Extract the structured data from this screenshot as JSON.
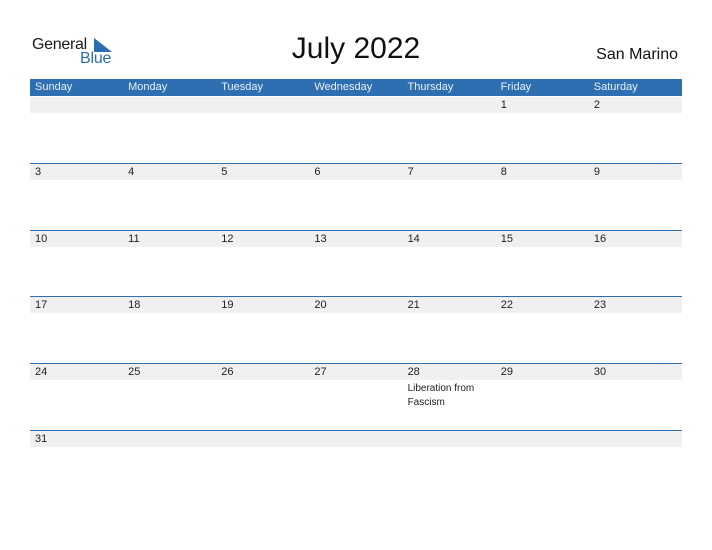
{
  "logo": {
    "word1": "General",
    "word2": "Blue"
  },
  "title": "July 2022",
  "country": "San Marino",
  "colors": {
    "accent": "#2e6fb1",
    "strip": "#f0f0f0"
  },
  "weekdays": [
    "Sunday",
    "Monday",
    "Tuesday",
    "Wednesday",
    "Thursday",
    "Friday",
    "Saturday"
  ],
  "weeks": [
    [
      {
        "day": ""
      },
      {
        "day": ""
      },
      {
        "day": ""
      },
      {
        "day": ""
      },
      {
        "day": ""
      },
      {
        "day": "1"
      },
      {
        "day": "2"
      }
    ],
    [
      {
        "day": "3"
      },
      {
        "day": "4"
      },
      {
        "day": "5"
      },
      {
        "day": "6"
      },
      {
        "day": "7"
      },
      {
        "day": "8"
      },
      {
        "day": "9"
      }
    ],
    [
      {
        "day": "10"
      },
      {
        "day": "11"
      },
      {
        "day": "12"
      },
      {
        "day": "13"
      },
      {
        "day": "14"
      },
      {
        "day": "15"
      },
      {
        "day": "16"
      }
    ],
    [
      {
        "day": "17"
      },
      {
        "day": "18"
      },
      {
        "day": "19"
      },
      {
        "day": "20"
      },
      {
        "day": "21"
      },
      {
        "day": "22"
      },
      {
        "day": "23"
      }
    ],
    [
      {
        "day": "24"
      },
      {
        "day": "25"
      },
      {
        "day": "26"
      },
      {
        "day": "27"
      },
      {
        "day": "28",
        "event": "Liberation from Fascism"
      },
      {
        "day": "29"
      },
      {
        "day": "30"
      }
    ],
    [
      {
        "day": "31"
      },
      {
        "day": ""
      },
      {
        "day": ""
      },
      {
        "day": ""
      },
      {
        "day": ""
      },
      {
        "day": ""
      },
      {
        "day": ""
      }
    ]
  ]
}
